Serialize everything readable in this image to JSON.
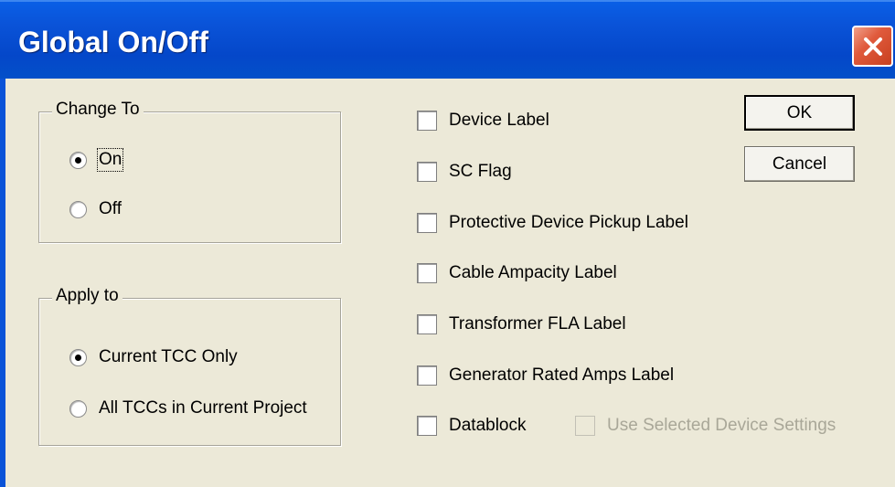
{
  "window": {
    "title": "Global On/Off"
  },
  "change_to": {
    "legend": "Change To",
    "options": [
      {
        "label": "On",
        "selected": true
      },
      {
        "label": "Off",
        "selected": false
      }
    ]
  },
  "apply_to": {
    "legend": "Apply to",
    "options": [
      {
        "label": "Current TCC Only",
        "selected": true
      },
      {
        "label": "All TCCs in Current Project",
        "selected": false
      }
    ]
  },
  "labels": {
    "items": [
      {
        "label": "Device Label",
        "checked": false
      },
      {
        "label": "SC Flag",
        "checked": false
      },
      {
        "label": "Protective Device Pickup Label",
        "checked": false
      },
      {
        "label": "Cable Ampacity Label",
        "checked": false
      },
      {
        "label": "Transformer FLA Label",
        "checked": false
      },
      {
        "label": "Generator Rated Amps Label",
        "checked": false
      },
      {
        "label": "Datablock",
        "checked": false
      }
    ],
    "use_selected": {
      "label": "Use Selected Device Settings",
      "checked": false,
      "enabled": false
    }
  },
  "buttons": {
    "ok": "OK",
    "cancel": "Cancel"
  },
  "colors": {
    "titlebar": "#0a53d8",
    "dialog_bg": "#ece9d8",
    "close": "#e05a3c"
  }
}
